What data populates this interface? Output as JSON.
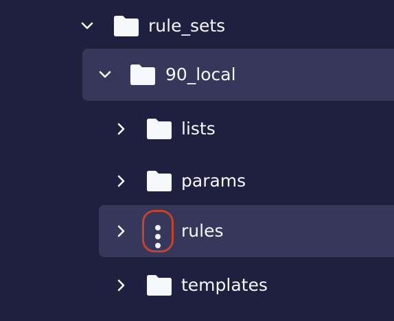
{
  "tree": {
    "items": [
      {
        "label": "rule_sets",
        "expanded": true,
        "icon": "folder-icon"
      },
      {
        "label": "90_local",
        "expanded": true,
        "icon": "folder-icon"
      },
      {
        "label": "lists",
        "expanded": false,
        "icon": "folder-icon"
      },
      {
        "label": "params",
        "expanded": false,
        "icon": "folder-icon"
      },
      {
        "label": "rules",
        "expanded": false,
        "icon": "kebab-menu-icon"
      },
      {
        "label": "templates",
        "expanded": false,
        "icon": "folder-icon"
      }
    ]
  },
  "colors": {
    "background": "#1f2040",
    "row_highlight": "#35385a",
    "folder": "#f7f8fc",
    "kebab_ring": "#c8412b"
  }
}
